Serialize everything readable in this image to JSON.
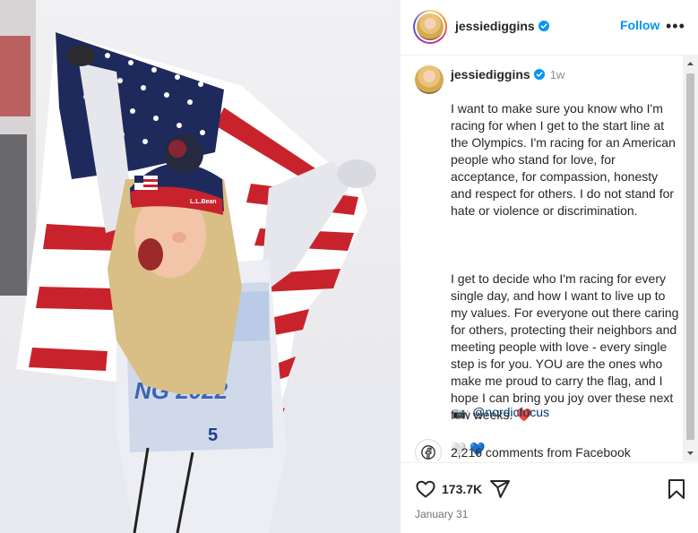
{
  "header": {
    "username": "jessiediggins",
    "follow_label": "Follow",
    "more_label": "•••"
  },
  "caption": {
    "username": "jessiediggins",
    "time": "1w",
    "paragraph_1": "I want to make sure you know who I'm racing for when I get to the start line at the Olympics. I'm racing for an American people who stand for love, for acceptance, for compassion, honesty and respect for others. I do not stand for hate or violence or discrimination.",
    "paragraph_2": "I get to decide who I'm racing for every single day, and how I want to live up to my values. For everyone out there caring for others, protecting their neighbors and meeting people with love - every single step is for you. YOU are the ones who make me proud to carry the flag, and I hope I can bring you joy over these next few weeks. ❤️",
    "hearts": "🤍 💙",
    "credit_emoji": "📷:",
    "credit_link": "@nordicfocus"
  },
  "facebook": {
    "comments_text": "2,216 comments from Facebook"
  },
  "actions": {
    "like_count": "173.7K",
    "date": "January 31"
  },
  "colors": {
    "accent": "#0095f6",
    "link": "#00376b",
    "muted": "#8e8e8e"
  },
  "icons": [
    "verified-icon",
    "heart-icon",
    "share-icon",
    "bookmark-icon",
    "facebook-icon",
    "more-icon"
  ]
}
